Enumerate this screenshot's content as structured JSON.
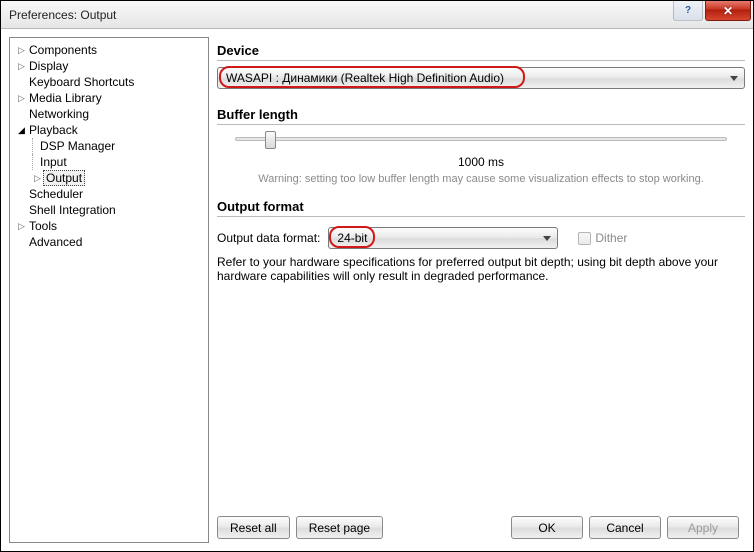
{
  "window": {
    "title": "Preferences: Output"
  },
  "tree": {
    "items": [
      {
        "label": "Components",
        "expanded": false,
        "children": false
      },
      {
        "label": "Display",
        "expanded": false,
        "children": true
      },
      {
        "label": "Keyboard Shortcuts",
        "expanded": false,
        "children": false
      },
      {
        "label": "Media Library",
        "expanded": false,
        "children": true
      },
      {
        "label": "Networking",
        "expanded": false,
        "children": false
      },
      {
        "label": "Playback",
        "expanded": true,
        "children": true
      },
      {
        "label": "Scheduler",
        "expanded": false,
        "children": false
      },
      {
        "label": "Shell Integration",
        "expanded": false,
        "children": false
      },
      {
        "label": "Tools",
        "expanded": false,
        "children": true
      },
      {
        "label": "Advanced",
        "expanded": false,
        "children": false
      }
    ],
    "playback_children": [
      {
        "label": "DSP Manager"
      },
      {
        "label": "Input"
      },
      {
        "label": "Output",
        "selected": true,
        "has_children": true
      }
    ]
  },
  "device": {
    "heading": "Device",
    "selected": "WASAPI : Динамики (Realtek High Definition Audio)"
  },
  "buffer": {
    "heading": "Buffer length",
    "value_text": "1000 ms",
    "warning": "Warning: setting too low buffer length may cause some visualization effects to stop working."
  },
  "output_format": {
    "heading": "Output format",
    "label": "Output data format:",
    "selected": "24-bit",
    "dither_label": "Dither",
    "help": "Refer to your hardware specifications for preferred output bit depth; using bit depth above your hardware capabilities will only result in degraded performance."
  },
  "buttons": {
    "reset_all": "Reset all",
    "reset_page": "Reset page",
    "ok": "OK",
    "cancel": "Cancel",
    "apply": "Apply"
  }
}
